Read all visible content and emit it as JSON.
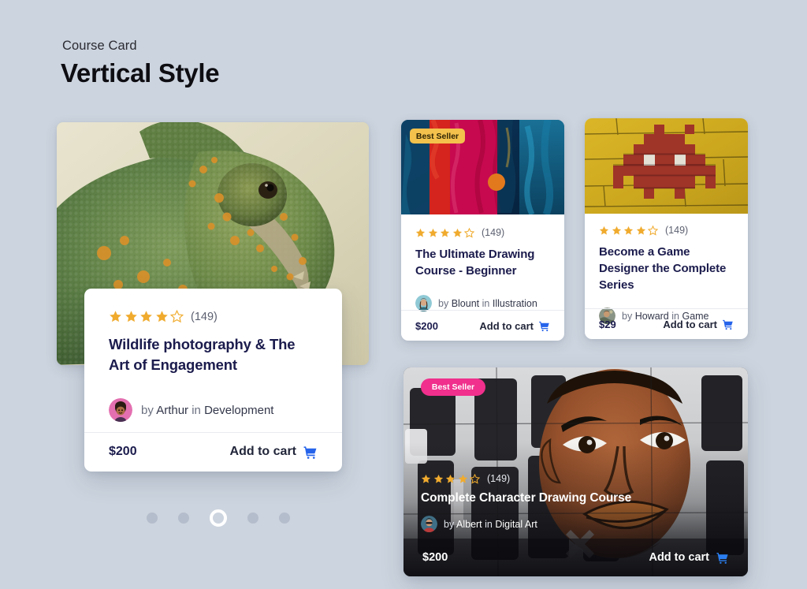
{
  "header": {
    "eyebrow": "Course Card",
    "title": "Vertical Style"
  },
  "theme": {
    "page_bg": "#ccd4df",
    "card_bg": "#ffffff",
    "title_color": "#1b1b4d",
    "muted_text": "#6b7080",
    "star_color": "#f0ab2e",
    "cart_icon_color": "#2563eb",
    "badge_gold_bg": "#f3c14c",
    "badge_pink_bg": "#f0308c",
    "divider": "#e9ebf0",
    "dot_inactive": "#b4bdcb",
    "dot_active": "#ffffff"
  },
  "icons": {
    "cart": "shopping-cart-icon",
    "star_filled": "star-filled-icon",
    "star_outline": "star-outline-icon"
  },
  "cards": [
    {
      "id": "hero",
      "image_alt": "chameleon-photo",
      "rating": 4,
      "max_rating": 5,
      "review_count": "(149)",
      "title": "Wildlife photography & The Art of Engagement",
      "author_prefix": "by",
      "author": "Arthur",
      "category_prefix": "in",
      "category": "Development",
      "price": "$200",
      "cta": "Add to cart",
      "badge": null
    },
    {
      "id": "card2",
      "image_alt": "abstract-paint-photo",
      "rating": 4,
      "max_rating": 5,
      "review_count": "(149)",
      "title": "The Ultimate Drawing Course - Beginner",
      "author_prefix": "by",
      "author": "Blount",
      "category_prefix": "in",
      "category": "Illustration",
      "price": "$200",
      "cta": "Add to cart",
      "badge": "Best Seller"
    },
    {
      "id": "card3",
      "image_alt": "space-invader-mosaic-photo",
      "rating": 4,
      "max_rating": 5,
      "review_count": "(149)",
      "title": "Become a Game Designer the Complete Series",
      "author_prefix": "by",
      "author": "Howard",
      "category_prefix": "in",
      "category": "Game",
      "price": "$29",
      "cta": "Add to cart",
      "badge": null
    },
    {
      "id": "card4",
      "image_alt": "street-art-portrait-photo",
      "rating": 4,
      "max_rating": 5,
      "review_count": "(149)",
      "title": "Complete Character Drawing Course",
      "author_prefix": "by",
      "author": "Albert",
      "category_prefix": "in",
      "category": "Digital Art",
      "price": "$200",
      "cta": "Add to cart",
      "badge": "Best Seller"
    }
  ],
  "pagination": {
    "total": 5,
    "active_index": 2
  }
}
